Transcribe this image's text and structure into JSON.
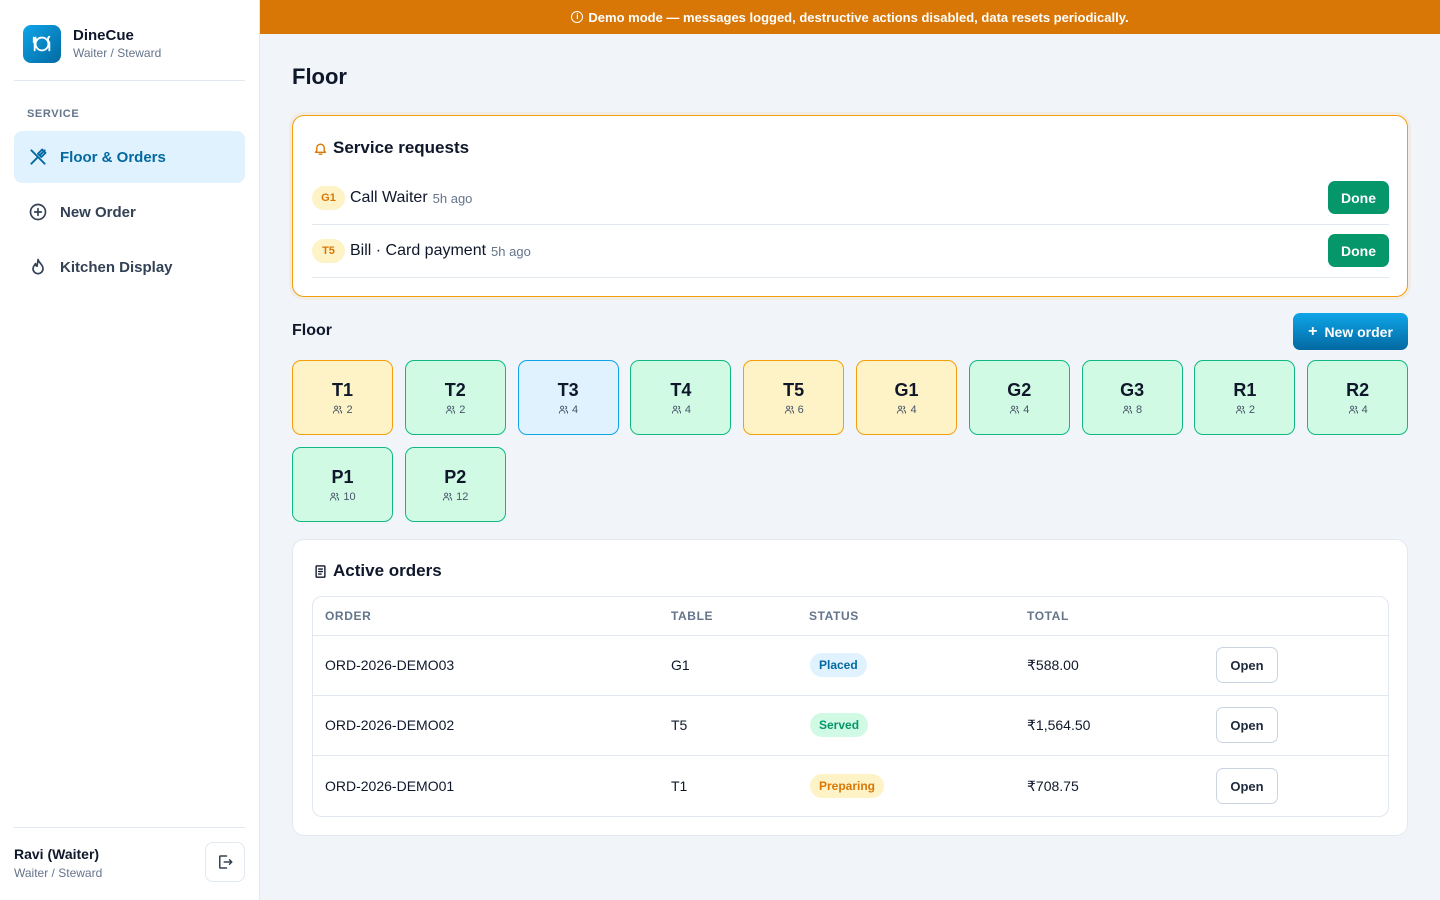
{
  "brand": {
    "name": "DineCue",
    "role": "Waiter / Steward"
  },
  "banner": {
    "text": "Demo mode — messages logged, destructive actions disabled, data resets periodically."
  },
  "sidebar": {
    "section_label": "SERVICE",
    "items": [
      {
        "label": "Floor & Orders",
        "icon": "utensils-icon",
        "active": true
      },
      {
        "label": "New Order",
        "icon": "plus-circle-icon",
        "active": false
      },
      {
        "label": "Kitchen Display",
        "icon": "flame-icon",
        "active": false
      }
    ]
  },
  "user": {
    "name": "Ravi (Waiter)",
    "role": "Waiter / Steward"
  },
  "page": {
    "title": "Floor"
  },
  "service_requests": {
    "title": "Service requests",
    "items": [
      {
        "table": "G1",
        "text": "Call Waiter",
        "time": "5h ago",
        "action": "Done"
      },
      {
        "table": "T5",
        "text": "Bill · Card payment",
        "time": "5h ago",
        "action": "Done"
      }
    ]
  },
  "floor": {
    "title": "Floor",
    "new_order_label": "New order",
    "tables": [
      {
        "name": "T1",
        "seats": "2",
        "state": "occupied"
      },
      {
        "name": "T2",
        "seats": "2",
        "state": "free"
      },
      {
        "name": "T3",
        "seats": "4",
        "state": "reserved"
      },
      {
        "name": "T4",
        "seats": "4",
        "state": "free"
      },
      {
        "name": "T5",
        "seats": "6",
        "state": "occupied"
      },
      {
        "name": "G1",
        "seats": "4",
        "state": "occupied"
      },
      {
        "name": "G2",
        "seats": "4",
        "state": "free"
      },
      {
        "name": "G3",
        "seats": "8",
        "state": "free"
      },
      {
        "name": "R1",
        "seats": "2",
        "state": "free"
      },
      {
        "name": "R2",
        "seats": "4",
        "state": "free"
      },
      {
        "name": "P1",
        "seats": "10",
        "state": "free"
      },
      {
        "name": "P2",
        "seats": "12",
        "state": "free"
      }
    ]
  },
  "orders": {
    "title": "Active orders",
    "columns": [
      "ORDER",
      "TABLE",
      "STATUS",
      "TOTAL"
    ],
    "rows": [
      {
        "order": "ORD-2026-DEMO03",
        "table": "G1",
        "status": "Placed",
        "status_kind": "placed",
        "total": "₹588.00",
        "action": "Open"
      },
      {
        "order": "ORD-2026-DEMO02",
        "table": "T5",
        "status": "Served",
        "status_kind": "served",
        "total": "₹1,564.50",
        "action": "Open"
      },
      {
        "order": "ORD-2026-DEMO01",
        "table": "T1",
        "status": "Preparing",
        "status_kind": "preparing",
        "total": "₹708.75",
        "action": "Open"
      }
    ]
  },
  "colors": {
    "accent": "#0369a1",
    "banner": "#d97706",
    "success": "#059669",
    "warning": "#f59e0b"
  }
}
